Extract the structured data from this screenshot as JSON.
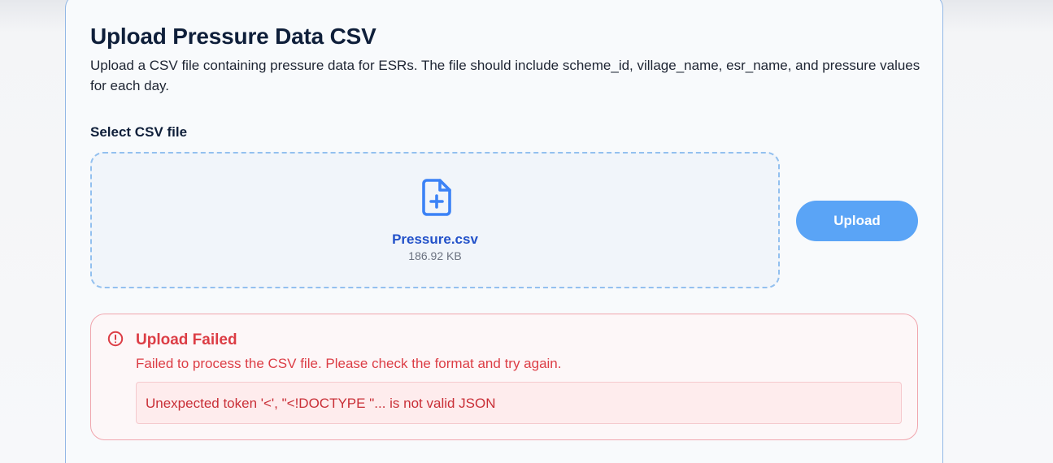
{
  "page": {
    "title": "Upload Pressure Data CSV",
    "description": "Upload a CSV file containing pressure data for ESRs. The file should include scheme_id, village_name, esr_name, and pressure values for each day."
  },
  "file_input": {
    "label": "Select CSV file",
    "file_name": "Pressure.csv",
    "file_size": "186.92 KB",
    "icon": "file-plus-icon"
  },
  "actions": {
    "upload_label": "Upload"
  },
  "error": {
    "icon": "alert-circle-icon",
    "title": "Upload Failed",
    "message": "Failed to process the CSV file. Please check the format and try again.",
    "detail": "Unexpected token '<', \"<!DOCTYPE \"... is not valid JSON"
  },
  "colors": {
    "primary": "#5aa4f6",
    "error": "#dc3d45",
    "title": "#0f1f3a"
  }
}
